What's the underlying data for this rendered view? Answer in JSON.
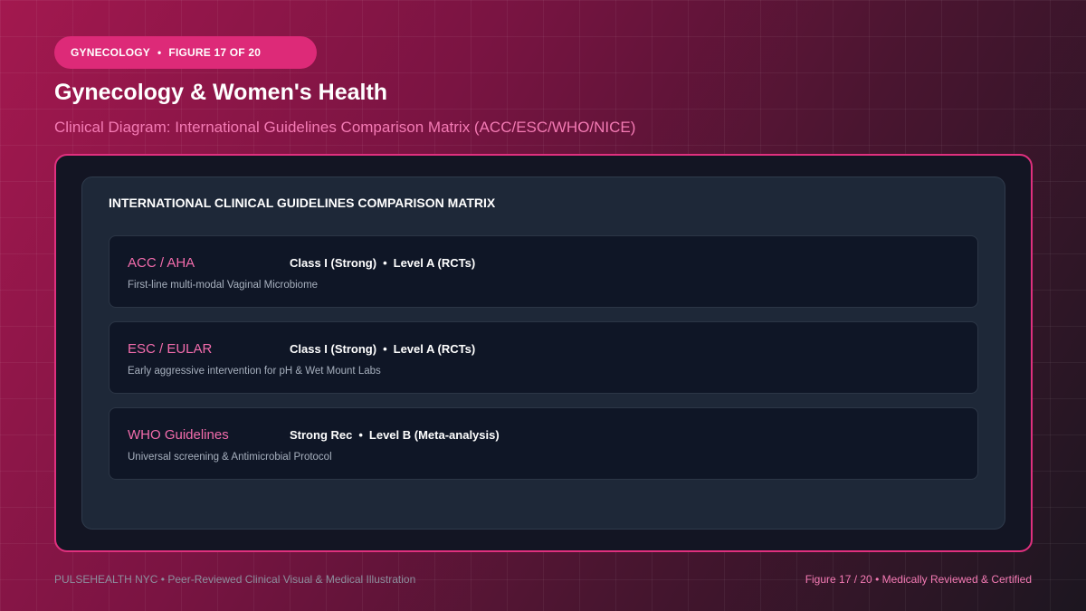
{
  "header": {
    "badge": {
      "category": "GYNECOLOGY",
      "separator": "•",
      "figure": "FIGURE 17 OF 20"
    },
    "title": "Gynecology & Women's Health",
    "subtitle": "Clinical Diagram: International Guidelines Comparison Matrix (ACC/ESC/WHO/NICE)"
  },
  "matrix": {
    "title": "INTERNATIONAL CLINICAL GUIDELINES COMPARISON MATRIX",
    "rows": [
      {
        "org": "ACC / AHA",
        "strength": "Class I (Strong)",
        "separator": "•",
        "level": "Level A (RCTs)",
        "description": "First-line multi-modal Vaginal Microbiome"
      },
      {
        "org": "ESC / EULAR",
        "strength": "Class I (Strong)",
        "separator": "•",
        "level": "Level A (RCTs)",
        "description": "Early aggressive intervention for pH & Wet Mount Labs"
      },
      {
        "org": "WHO Guidelines",
        "strength": "Strong Rec",
        "separator": "•",
        "level": "Level B (Meta-analysis)",
        "description": "Universal screening & Antimicrobial Protocol"
      }
    ]
  },
  "footer": {
    "left": "PULSEHEALTH NYC  •  Peer-Reviewed Clinical Visual & Medical Illustration",
    "right": "Figure 17 / 20  •  Medically Reviewed & Certified"
  },
  "colors": {
    "accent_pink": "#dd2a78",
    "org_label": "#f36cac",
    "subtitle": "#f47ab4",
    "panel": "#131523",
    "card": "#0f1626"
  }
}
